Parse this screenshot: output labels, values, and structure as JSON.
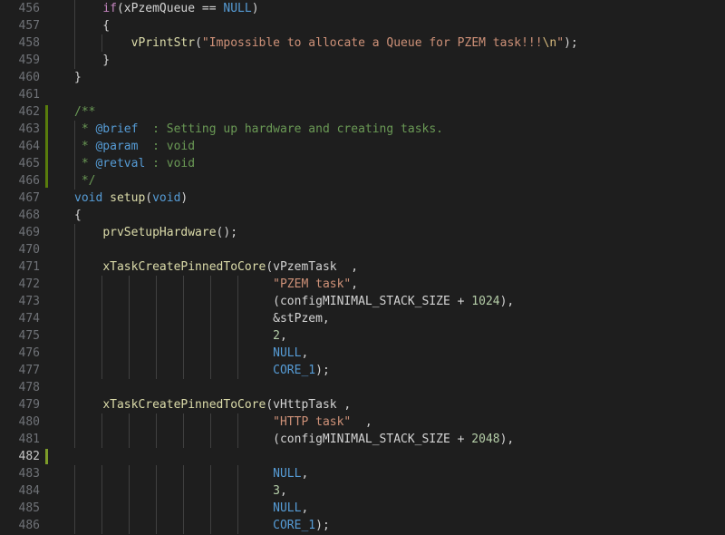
{
  "editor": {
    "language": "cpp",
    "background_color": "#1e1e1e",
    "gutter_color": "#1e1e1e",
    "line_number_color": "#6f7277",
    "active_line_number_color": "#c6c6c6",
    "indent_guide_color": "#404040",
    "change_marker_color": "#587c0c",
    "caret_color": "#7d9c29",
    "first_visible_line": 456,
    "last_visible_line": 486,
    "active_line": 482,
    "cursor": {
      "line": 482,
      "column": 1
    }
  },
  "theme_tokens": {
    "keyword": "#c586c0",
    "type": "#569cd6",
    "function": "#dcdcaa",
    "string": "#ce9178",
    "escape": "#d7ba7d",
    "number": "#b5cea8",
    "plain": "#d4d4d4",
    "comment": "#6a9955",
    "doc_tag": "#569cd6"
  },
  "lines": [
    {
      "number": 456,
      "indent_guides": 1,
      "changed": false,
      "text": "    if(xPzemQueue == NULL)",
      "tokens": [
        {
          "t": "    ",
          "c": "t-plain"
        },
        {
          "t": "if",
          "c": "t-key"
        },
        {
          "t": "(xPzemQueue ",
          "c": "t-plain"
        },
        {
          "t": "==",
          "c": "t-op"
        },
        {
          "t": " ",
          "c": "t-plain"
        },
        {
          "t": "NULL",
          "c": "t-type"
        },
        {
          "t": ")",
          "c": "t-plain"
        }
      ]
    },
    {
      "number": 457,
      "indent_guides": 1,
      "changed": false,
      "text": "    {",
      "tokens": [
        {
          "t": "    {",
          "c": "t-plain"
        }
      ]
    },
    {
      "number": 458,
      "indent_guides": 2,
      "changed": false,
      "text": "        vPrintStr(\"Impossible to allocate a Queue for PZEM task!!!\\n\");",
      "tokens": [
        {
          "t": "        ",
          "c": "t-plain"
        },
        {
          "t": "vPrintStr",
          "c": "t-fn"
        },
        {
          "t": "(",
          "c": "t-plain"
        },
        {
          "t": "\"Impossible to allocate a Queue for PZEM task!!!",
          "c": "t-str"
        },
        {
          "t": "\\n",
          "c": "t-esc"
        },
        {
          "t": "\"",
          "c": "t-str"
        },
        {
          "t": ");",
          "c": "t-plain"
        }
      ]
    },
    {
      "number": 459,
      "indent_guides": 1,
      "changed": false,
      "text": "    }",
      "tokens": [
        {
          "t": "    }",
          "c": "t-plain"
        }
      ]
    },
    {
      "number": 460,
      "indent_guides": 0,
      "changed": false,
      "text": "}",
      "tokens": [
        {
          "t": "}",
          "c": "t-plain"
        }
      ]
    },
    {
      "number": 461,
      "indent_guides": 0,
      "changed": false,
      "text": "",
      "tokens": []
    },
    {
      "number": 462,
      "indent_guides": 0,
      "changed": true,
      "text": "/**",
      "tokens": [
        {
          "t": "/**",
          "c": "t-comment"
        }
      ]
    },
    {
      "number": 463,
      "indent_guides": 1,
      "changed": true,
      "text": " * @brief  : Setting up hardware and creating tasks.",
      "tokens": [
        {
          "t": " * ",
          "c": "t-comment"
        },
        {
          "t": "@brief",
          "c": "t-doctag"
        },
        {
          "t": "  : Setting up hardware and creating tasks.",
          "c": "t-comment"
        }
      ]
    },
    {
      "number": 464,
      "indent_guides": 1,
      "changed": true,
      "text": " * @param  : void",
      "tokens": [
        {
          "t": " * ",
          "c": "t-comment"
        },
        {
          "t": "@param",
          "c": "t-doctag"
        },
        {
          "t": "  : void",
          "c": "t-comment"
        }
      ]
    },
    {
      "number": 465,
      "indent_guides": 1,
      "changed": true,
      "text": " * @retval : void",
      "tokens": [
        {
          "t": " * ",
          "c": "t-comment"
        },
        {
          "t": "@retval",
          "c": "t-doctag"
        },
        {
          "t": " : void",
          "c": "t-comment"
        }
      ]
    },
    {
      "number": 466,
      "indent_guides": 1,
      "changed": true,
      "text": " */",
      "tokens": [
        {
          "t": " */",
          "c": "t-comment"
        }
      ]
    },
    {
      "number": 467,
      "indent_guides": 0,
      "changed": false,
      "text": "void setup(void)",
      "tokens": [
        {
          "t": "void",
          "c": "t-type"
        },
        {
          "t": " ",
          "c": "t-plain"
        },
        {
          "t": "setup",
          "c": "t-fn"
        },
        {
          "t": "(",
          "c": "t-plain"
        },
        {
          "t": "void",
          "c": "t-type"
        },
        {
          "t": ")",
          "c": "t-plain"
        }
      ]
    },
    {
      "number": 468,
      "indent_guides": 0,
      "changed": false,
      "text": "{",
      "tokens": [
        {
          "t": "{",
          "c": "t-plain"
        }
      ]
    },
    {
      "number": 469,
      "indent_guides": 1,
      "changed": false,
      "text": "    prvSetupHardware();",
      "tokens": [
        {
          "t": "    ",
          "c": "t-plain"
        },
        {
          "t": "prvSetupHardware",
          "c": "t-fn"
        },
        {
          "t": "();",
          "c": "t-plain"
        }
      ]
    },
    {
      "number": 470,
      "indent_guides": 1,
      "changed": false,
      "text": "",
      "tokens": []
    },
    {
      "number": 471,
      "indent_guides": 1,
      "changed": false,
      "text": "    xTaskCreatePinnedToCore(vPzemTask  ,",
      "tokens": [
        {
          "t": "    ",
          "c": "t-plain"
        },
        {
          "t": "xTaskCreatePinnedToCore",
          "c": "t-fn"
        },
        {
          "t": "(vPzemTask  ,",
          "c": "t-plain"
        }
      ]
    },
    {
      "number": 472,
      "indent_guides": 7,
      "changed": false,
      "text": "                            \"PZEM task\",",
      "tokens": [
        {
          "t": "                            ",
          "c": "t-plain"
        },
        {
          "t": "\"PZEM task\"",
          "c": "t-str"
        },
        {
          "t": ",",
          "c": "t-plain"
        }
      ]
    },
    {
      "number": 473,
      "indent_guides": 7,
      "changed": false,
      "text": "                            (configMINIMAL_STACK_SIZE + 1024),",
      "tokens": [
        {
          "t": "                            (configMINIMAL_STACK_SIZE + ",
          "c": "t-plain"
        },
        {
          "t": "1024",
          "c": "t-num"
        },
        {
          "t": "),",
          "c": "t-plain"
        }
      ]
    },
    {
      "number": 474,
      "indent_guides": 7,
      "changed": false,
      "text": "                            &stPzem,",
      "tokens": [
        {
          "t": "                            &stPzem,",
          "c": "t-plain"
        }
      ]
    },
    {
      "number": 475,
      "indent_guides": 7,
      "changed": false,
      "text": "                            2,",
      "tokens": [
        {
          "t": "                            ",
          "c": "t-plain"
        },
        {
          "t": "2",
          "c": "t-num"
        },
        {
          "t": ",",
          "c": "t-plain"
        }
      ]
    },
    {
      "number": 476,
      "indent_guides": 7,
      "changed": false,
      "text": "                            NULL,",
      "tokens": [
        {
          "t": "                            ",
          "c": "t-plain"
        },
        {
          "t": "NULL",
          "c": "t-type"
        },
        {
          "t": ",",
          "c": "t-plain"
        }
      ]
    },
    {
      "number": 477,
      "indent_guides": 7,
      "changed": false,
      "text": "                            CORE_1);",
      "tokens": [
        {
          "t": "                            ",
          "c": "t-plain"
        },
        {
          "t": "CORE_1",
          "c": "t-type"
        },
        {
          "t": ");",
          "c": "t-plain"
        }
      ]
    },
    {
      "number": 478,
      "indent_guides": 1,
      "changed": false,
      "text": "",
      "tokens": []
    },
    {
      "number": 479,
      "indent_guides": 1,
      "changed": false,
      "text": "    xTaskCreatePinnedToCore(vHttpTask ,",
      "tokens": [
        {
          "t": "    ",
          "c": "t-plain"
        },
        {
          "t": "xTaskCreatePinnedToCore",
          "c": "t-fn"
        },
        {
          "t": "(vHttpTask ,",
          "c": "t-plain"
        }
      ]
    },
    {
      "number": 480,
      "indent_guides": 7,
      "changed": false,
      "text": "                            \"HTTP task\"  ,",
      "tokens": [
        {
          "t": "                            ",
          "c": "t-plain"
        },
        {
          "t": "\"HTTP task\"",
          "c": "t-str"
        },
        {
          "t": "  ,",
          "c": "t-plain"
        }
      ]
    },
    {
      "number": 481,
      "indent_guides": 7,
      "changed": false,
      "text": "                            (configMINIMAL_STACK_SIZE + 2048),",
      "tokens": [
        {
          "t": "                            (configMINIMAL_STACK_SIZE + ",
          "c": "t-plain"
        },
        {
          "t": "2048",
          "c": "t-num"
        },
        {
          "t": "),",
          "c": "t-plain"
        }
      ]
    },
    {
      "number": 482,
      "indent_guides": 0,
      "changed": false,
      "active": true,
      "text": "",
      "tokens": []
    },
    {
      "number": 483,
      "indent_guides": 7,
      "changed": false,
      "text": "                            NULL,",
      "tokens": [
        {
          "t": "                            ",
          "c": "t-plain"
        },
        {
          "t": "NULL",
          "c": "t-type"
        },
        {
          "t": ",",
          "c": "t-plain"
        }
      ]
    },
    {
      "number": 484,
      "indent_guides": 7,
      "changed": false,
      "text": "                            3,",
      "tokens": [
        {
          "t": "                            ",
          "c": "t-plain"
        },
        {
          "t": "3",
          "c": "t-num"
        },
        {
          "t": ",",
          "c": "t-plain"
        }
      ]
    },
    {
      "number": 485,
      "indent_guides": 7,
      "changed": false,
      "text": "                            NULL,",
      "tokens": [
        {
          "t": "                            ",
          "c": "t-plain"
        },
        {
          "t": "NULL",
          "c": "t-type"
        },
        {
          "t": ",",
          "c": "t-plain"
        }
      ]
    },
    {
      "number": 486,
      "indent_guides": 7,
      "changed": false,
      "text": "                            CORE_1);",
      "tokens": [
        {
          "t": "                            ",
          "c": "t-plain"
        },
        {
          "t": "CORE_1",
          "c": "t-type"
        },
        {
          "t": ");",
          "c": "t-plain"
        }
      ]
    }
  ]
}
